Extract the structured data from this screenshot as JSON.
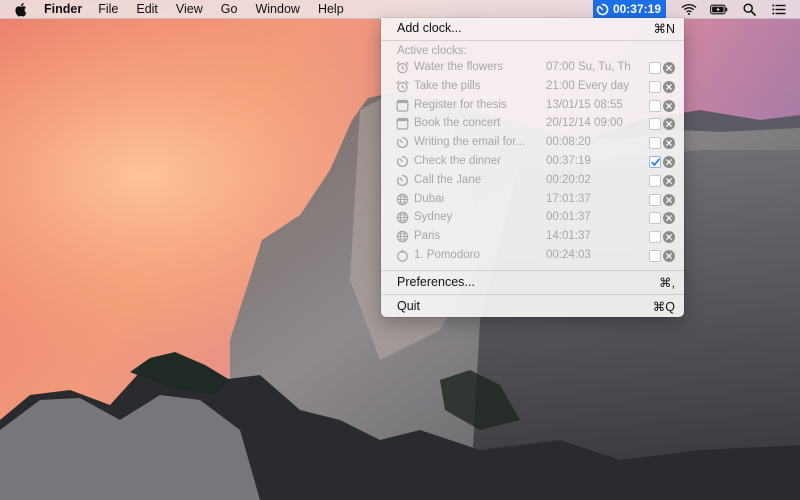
{
  "menubar": {
    "app_name": "Finder",
    "items": [
      "File",
      "Edit",
      "View",
      "Go",
      "Window",
      "Help"
    ],
    "clock_status": "00:37:19",
    "accent_color": "#1d6fe8"
  },
  "dropdown": {
    "add_clock": {
      "label": "Add clock...",
      "shortcut": "⌘N"
    },
    "section_label": "Active clocks:",
    "clocks": [
      {
        "icon": "alarm-icon",
        "name": "Water the flowers",
        "value": "07:00 Su, Tu, Th",
        "checked": false
      },
      {
        "icon": "alarm-icon",
        "name": "Take the pills",
        "value": "21:00 Every day",
        "checked": false
      },
      {
        "icon": "calendar-icon",
        "name": "Register for thesis",
        "value": "13/01/15 08:55",
        "checked": false
      },
      {
        "icon": "calendar-icon",
        "name": "Book the concert",
        "value": "20/12/14 09:00",
        "checked": false
      },
      {
        "icon": "timer-icon",
        "name": "Writing the email for...",
        "value": "00:08:20",
        "checked": false
      },
      {
        "icon": "timer-icon",
        "name": "Check the dinner",
        "value": "00:37:19",
        "checked": true
      },
      {
        "icon": "timer-icon",
        "name": "Call the Jane",
        "value": "00:20:02",
        "checked": false
      },
      {
        "icon": "globe-icon",
        "name": "Dubai",
        "value": "17:01:37",
        "checked": false
      },
      {
        "icon": "globe-icon",
        "name": "Sydney",
        "value": "00:01:37",
        "checked": false
      },
      {
        "icon": "globe-icon",
        "name": "Paris",
        "value": "14:01:37",
        "checked": false
      },
      {
        "icon": "pomodoro-icon",
        "name": "1. Pomodoro",
        "value": "00:24:03",
        "checked": false
      }
    ],
    "preferences": {
      "label": "Preferences...",
      "shortcut": "⌘,"
    },
    "quit": {
      "label": "Quit",
      "shortcut": "⌘Q"
    }
  }
}
